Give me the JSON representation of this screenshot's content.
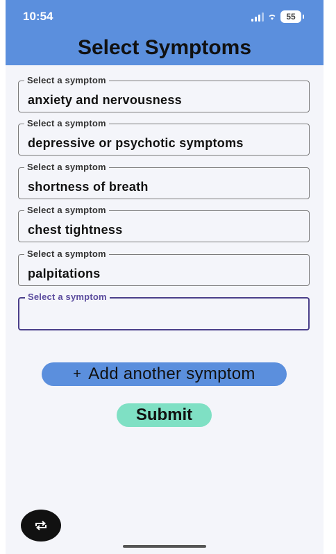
{
  "status": {
    "time": "10:54",
    "battery": "55"
  },
  "header": {
    "title": "Select Symptoms"
  },
  "fields": [
    {
      "label": "Select a symptom",
      "value": "anxiety and nervousness"
    },
    {
      "label": "Select a symptom",
      "value": "depressive or psychotic symptoms"
    },
    {
      "label": "Select a symptom",
      "value": "shortness of breath"
    },
    {
      "label": "Select a symptom",
      "value": "chest tightness"
    },
    {
      "label": "Select a symptom",
      "value": "palpitations"
    },
    {
      "label": "Select a symptom",
      "value": ""
    }
  ],
  "actions": {
    "add_label": "Add another symptom",
    "add_icon": "+",
    "submit_label": "Submit"
  },
  "icons": {
    "floating_button": "rotate-screen-icon"
  },
  "colors": {
    "header": "#5b8fdd",
    "submit": "#7fe0c4",
    "active_field": "#4a3f8a"
  }
}
